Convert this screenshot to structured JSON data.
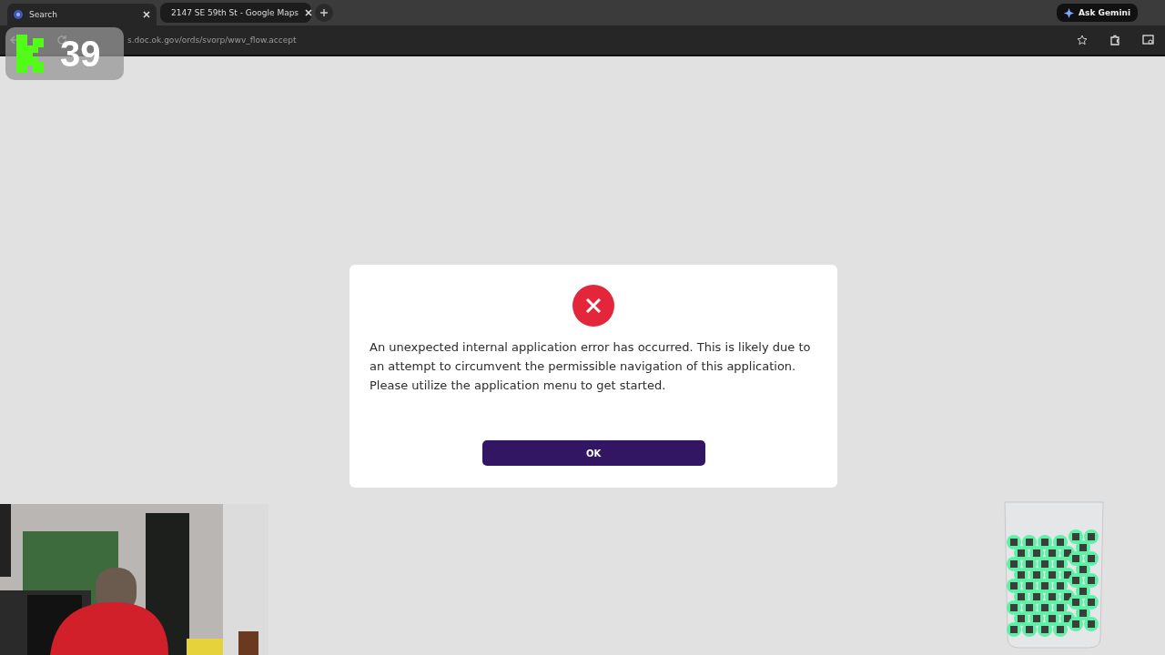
{
  "browser": {
    "tabs": [
      {
        "title": "Search",
        "kind": "search",
        "selected": true
      },
      {
        "title": "2147 SE 59th St - Google Maps",
        "kind": "maps",
        "selected": false
      }
    ],
    "address": "s.doc.ok.gov/ords/svorp/wwv_flow.accept",
    "ask_button": "Ask Gemini"
  },
  "dialog": {
    "message": "An unexpected internal application error has occurred. This is likely due to an attempt to circumvent the permissible navigation of this application. Please utilize the application menu to get started.",
    "button": "OK"
  },
  "overlay": {
    "counter": "39"
  }
}
